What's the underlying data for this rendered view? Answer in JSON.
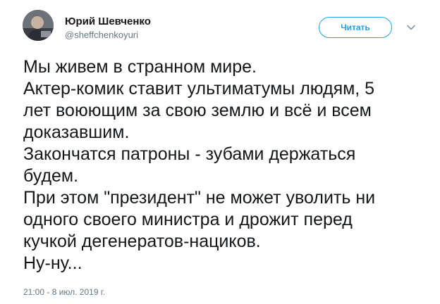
{
  "author": {
    "name": "Юрий Шевченко",
    "handle": "@sheffchenkoyuri"
  },
  "follow_label": "Читать",
  "tweet": {
    "lines": [
      "Мы живем в странном мире.",
      "Актер-комик ставит ультиматумы людям, 5",
      "лет воюющим за свою землю и всё и всем",
      "доказавшим.",
      "Закончатся патроны - зубами держаться",
      "будем.",
      "При этом \"президент\" не может уволить ни",
      "одного своего министра и дрожит перед",
      "кучкой дегенератов-нациков.",
      "Ну-ну..."
    ]
  },
  "timestamp": "21:00 - 8 июл. 2019 г.",
  "colors": {
    "accent": "#1da1f2",
    "text": "#14171a",
    "muted": "#657786"
  },
  "icons": {
    "caret": "chevron-down-icon",
    "avatar": "avatar"
  }
}
